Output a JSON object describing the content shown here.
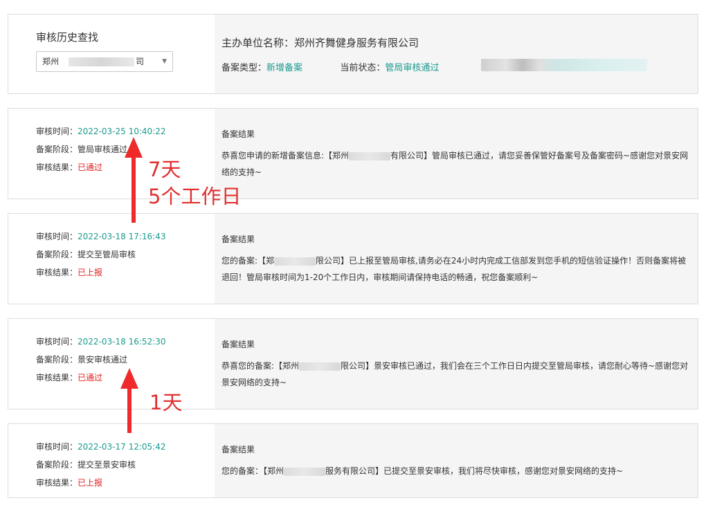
{
  "header": {
    "search_label": "审核历史查找",
    "select_value_start": "郑州",
    "select_value_end": "司"
  },
  "org": {
    "title": "主办单位名称：郑州齐舞健身服务有限公司",
    "type_label": "备案类型：",
    "type_value": "新增备案",
    "status_label": "当前状态：",
    "status_value": "管局审核通过"
  },
  "labels": {
    "time": "审核时间：",
    "stage": "备案阶段：",
    "result": "审核结果：",
    "result_title": "备案结果"
  },
  "records": [
    {
      "time": "2022-03-25 10:40:22",
      "stage": "管局审核通过",
      "result": "已通过",
      "msg_a": "恭喜您申请的新增备案信息:【郑州",
      "msg_b": "有限公司】管局审核已通过，请您妥善保管好备案号及备案密码~感谢您对景安网络的支持~"
    },
    {
      "time": "2022-03-18 17:16:43",
      "stage": "提交至管局审核",
      "result": "已上报",
      "msg_a": "您的备案:【郑",
      "msg_b": "限公司】已上报至管局审核,请务必在24小时内完成工信部发到您手机的短信验证操作！否则备案将被退回！管局审核时间为1-20个工作日内，审核期间请保持电话的畅通，祝您备案顺利~"
    },
    {
      "time": "2022-03-18 16:52:30",
      "stage": "景安审核通过",
      "result": "已通过",
      "msg_a": "恭喜您的备案:【郑州",
      "msg_b": "限公司】景安审核已通过，我们会在三个工作日日内提交至管局审核，请您耐心等待~感谢您对景安网络的支持~"
    },
    {
      "time": "2022-03-17 12:05:42",
      "stage": "提交至景安审核",
      "result": "已上报",
      "msg_a": "您的备案：【郑州",
      "msg_b": "服务有限公司】已提交至景安审核，我们将尽快审核，感谢您对景安网络的支持~"
    }
  ],
  "annotations": {
    "upper_days": "7天",
    "upper_workdays": "5个工作日",
    "lower_days": "1天"
  },
  "colors": {
    "accent_teal": "#1a9a8e",
    "status_red": "#e02020",
    "annotation_red": "#e03030"
  }
}
